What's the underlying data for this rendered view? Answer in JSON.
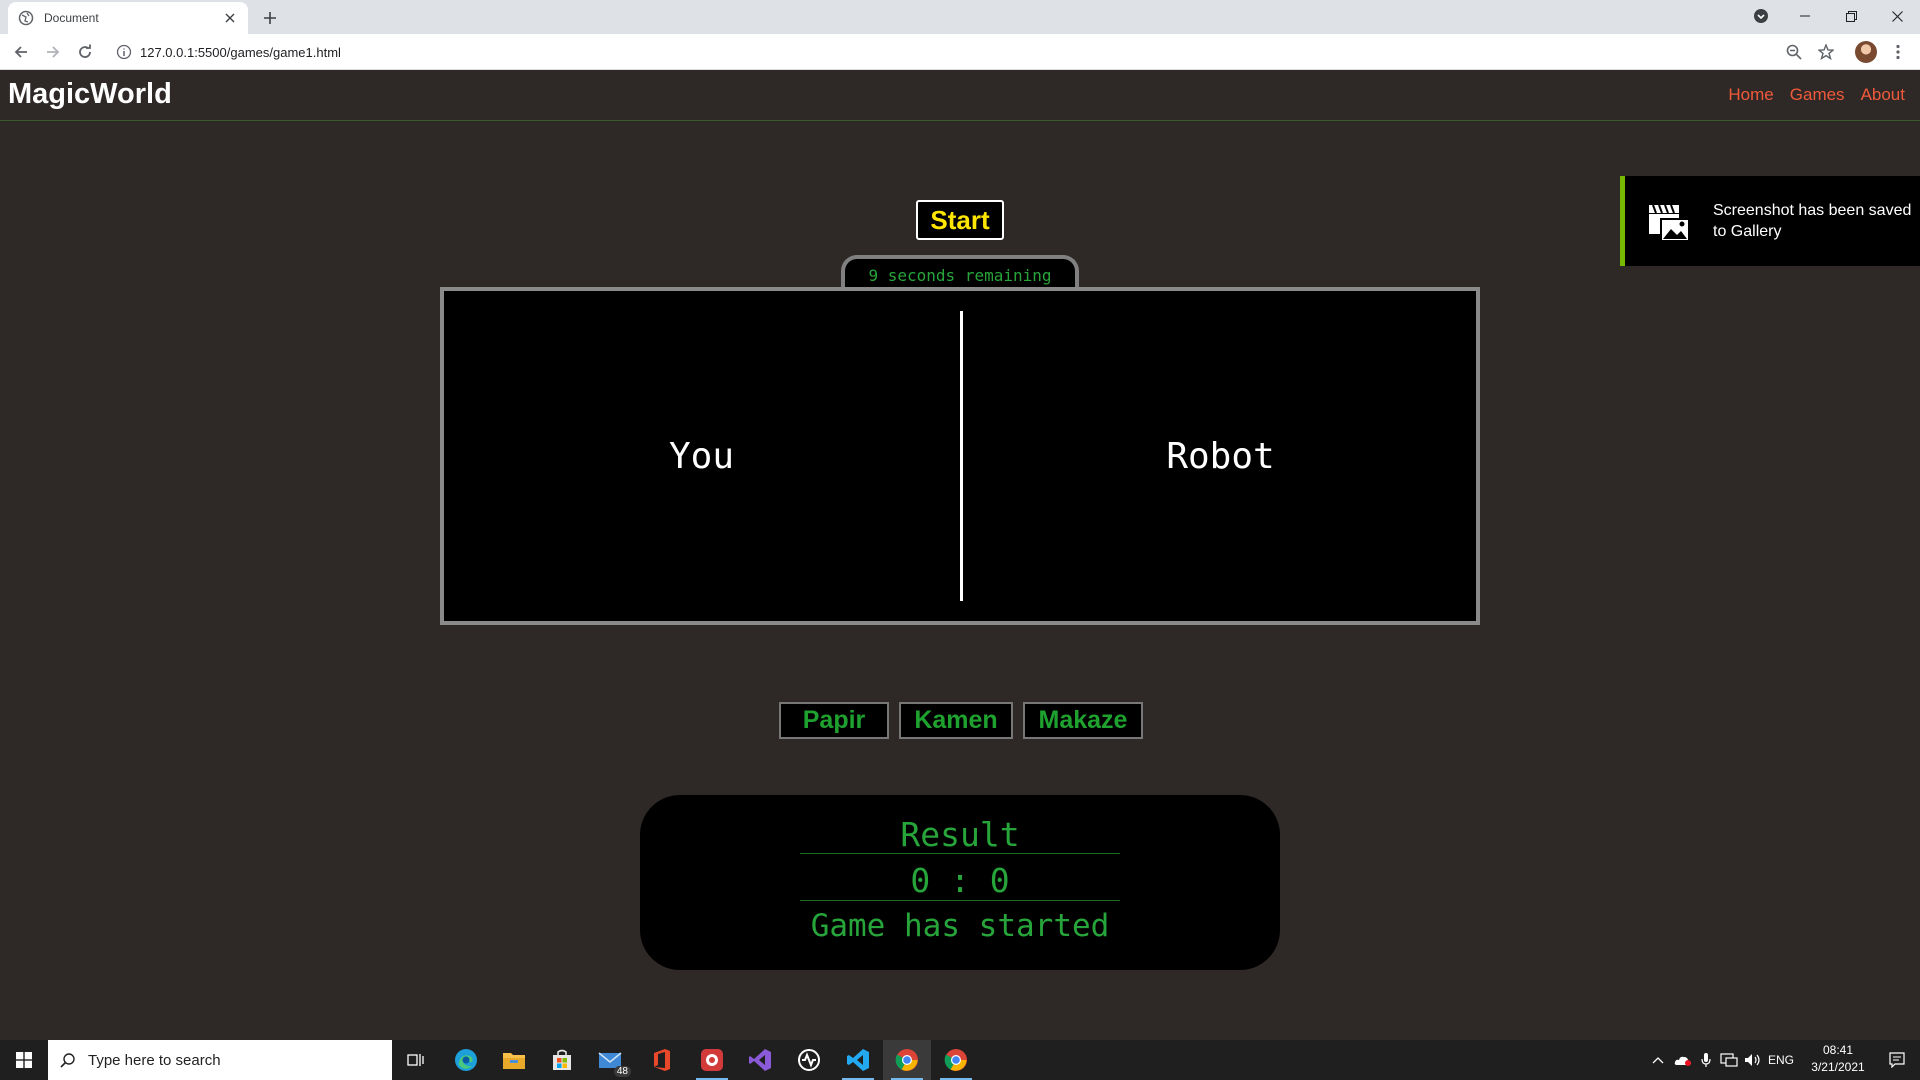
{
  "browser": {
    "tab_title": "Document",
    "url": "127.0.0.1:5500/games/game1.html"
  },
  "site": {
    "brand": "MagicWorld",
    "nav": [
      "Home",
      "Games",
      "About"
    ]
  },
  "game": {
    "start_label": "Start",
    "timer_text": "9 seconds remaining",
    "player_label": "You",
    "opponent_label": "Robot",
    "choices": [
      "Papir",
      "Kamen",
      "Makaze"
    ]
  },
  "result": {
    "title": "Result",
    "score": "0 : 0",
    "status": "Game has started"
  },
  "toast": {
    "message": "Screenshot has been saved to Gallery"
  },
  "taskbar": {
    "search_placeholder": "Type here to search",
    "mail_badge": "48",
    "language": "ENG",
    "time": "08:41",
    "date": "3/21/2021"
  },
  "colors": {
    "page_bg": "#2e2826",
    "nav_link": "#f05a3c",
    "start_text": "#ffe600",
    "game_green": "#27a53a",
    "toast_accent": "#76b900"
  }
}
